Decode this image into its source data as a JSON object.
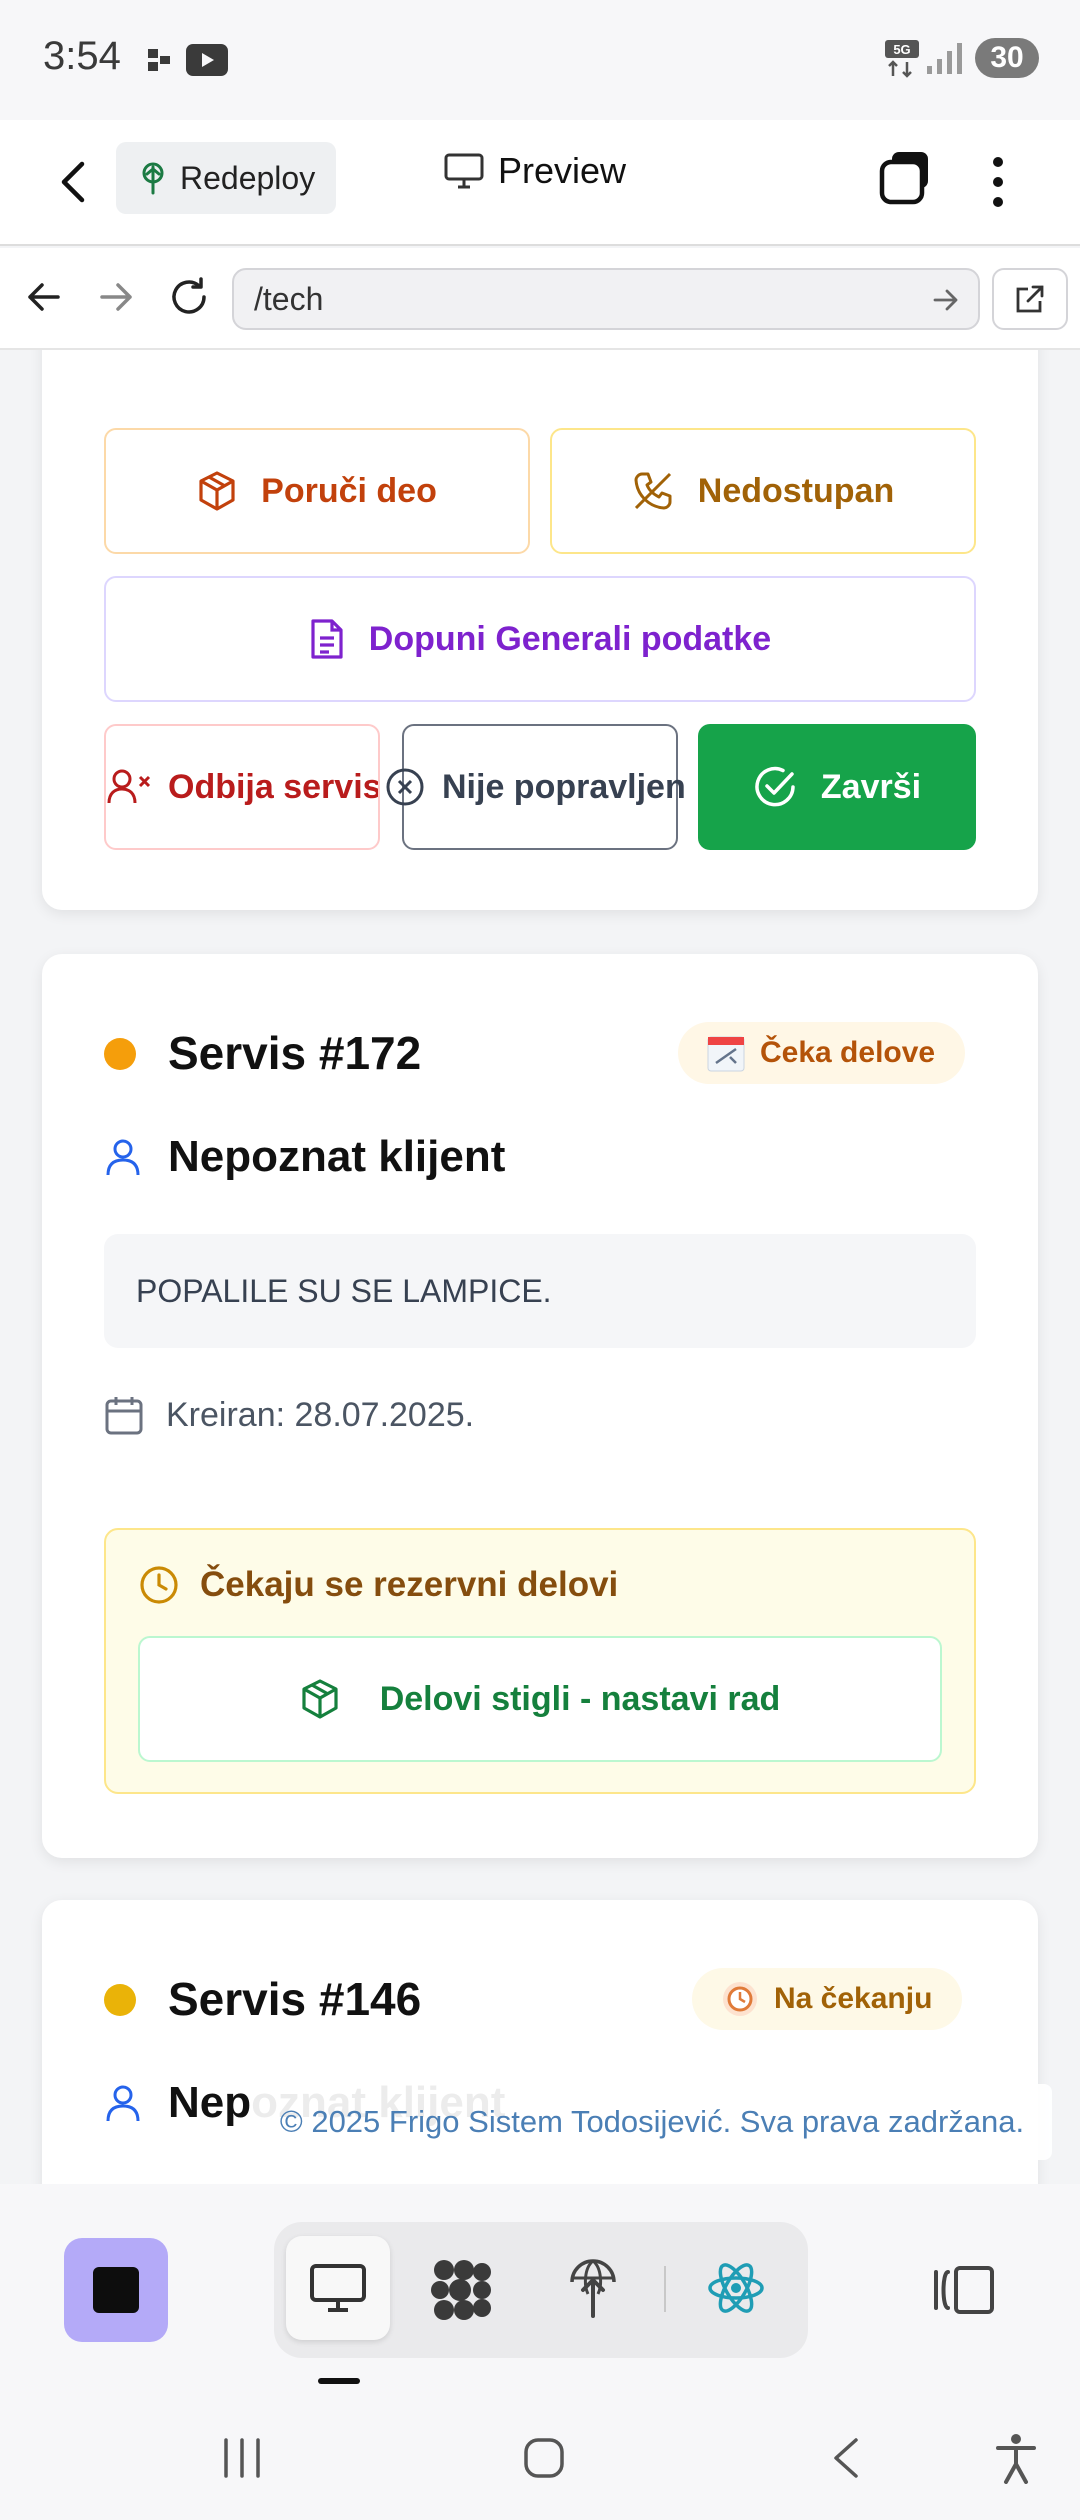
{
  "status_bar": {
    "time": "3:54",
    "network": "5G",
    "battery": "30"
  },
  "app_bar": {
    "redeploy_label": "Redeploy",
    "preview_label": "Preview"
  },
  "browser": {
    "url": "/tech"
  },
  "actions": {
    "order_part": "Poruči deo",
    "unavailable": "Nedostupan",
    "complete_generali": "Dopuni Generali podatke",
    "refuses_service": "Odbija servis",
    "not_repaired": "Nije popravljen",
    "finish": "Završi"
  },
  "services": [
    {
      "title": "Servis #172",
      "status_color": "#f59e0b",
      "badge": "Čeka delove",
      "badge_bg": "#fff7e6",
      "badge_color": "#b45309",
      "client": "Nepoznat klijent",
      "description": "POPALILE SU SE LAMPICE.",
      "created": "Kreiran: 28.07.2025.",
      "waiting_title": "Čekaju se rezervni delovi",
      "parts_arrived_button": "Delovi stigli - nastavi rad"
    },
    {
      "title": "Servis #146",
      "status_color": "#eab308",
      "badge": "Na čekanju",
      "badge_bg": "#fef9e7",
      "badge_color": "#a16207",
      "client": "Nepoznat klijent"
    }
  ],
  "footer": {
    "copyright": "© 2025 Frigo Sistem Todosijević. Sva prava zadržana."
  }
}
